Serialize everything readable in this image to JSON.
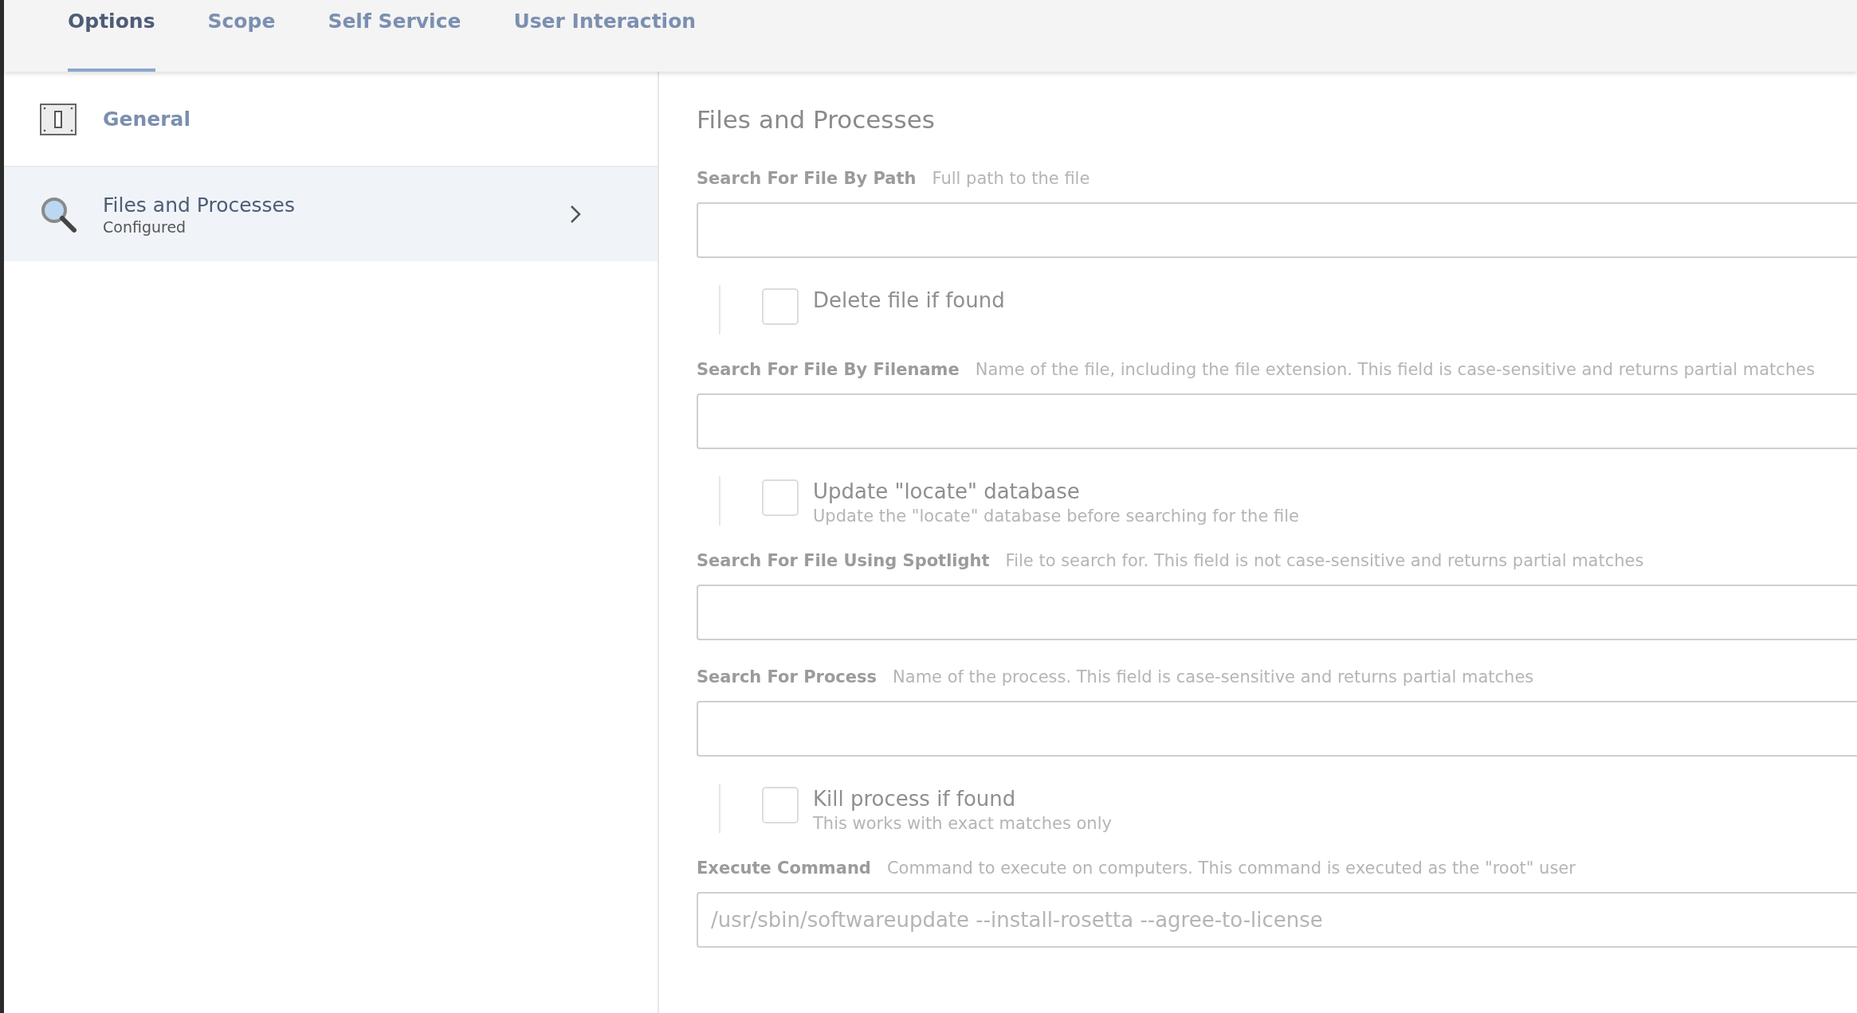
{
  "tabs": [
    {
      "label": "Options",
      "selected": true
    },
    {
      "label": "Scope",
      "selected": false
    },
    {
      "label": "Self Service",
      "selected": false
    },
    {
      "label": "User Interaction",
      "selected": false
    }
  ],
  "sidebar": {
    "items": [
      {
        "label": "General",
        "kind": "switch",
        "selected": false
      },
      {
        "label": "Files and Processes",
        "subtitle": "Configured",
        "kind": "magnifier",
        "selected": true
      }
    ]
  },
  "panel": {
    "title": "Files and Processes",
    "items": [
      {
        "kind": "text",
        "label": "Search For File By Path",
        "hint": "Full path to the file"
      },
      {
        "kind": "checkbox",
        "label": "Delete file if found",
        "checked": false
      },
      {
        "kind": "text",
        "label": "Search For File By Filename",
        "hint": "Name of the file, including the file extension. This field is case-sensitive and returns partial matches"
      },
      {
        "kind": "checkbox",
        "label": "Update \"locate\" database",
        "description": "Update the \"locate\" database before searching for the file",
        "checked": false
      },
      {
        "kind": "text",
        "label": "Search For File Using Spotlight",
        "hint": "File to search for. This field is not case-sensitive and returns partial matches"
      },
      {
        "kind": "text",
        "label": "Search For Process",
        "hint": "Name of the process. This field is case-sensitive and returns partial matches"
      },
      {
        "kind": "checkbox",
        "label": "Kill process if found",
        "description": "This works with exact matches only",
        "checked": false
      },
      {
        "kind": "text",
        "label": "Execute Command",
        "hint": "Command to execute on computers. This command is executed as the \"root\" user",
        "value": "/usr/sbin/softwareupdate --install-rosetta --agree-to-license"
      }
    ]
  }
}
